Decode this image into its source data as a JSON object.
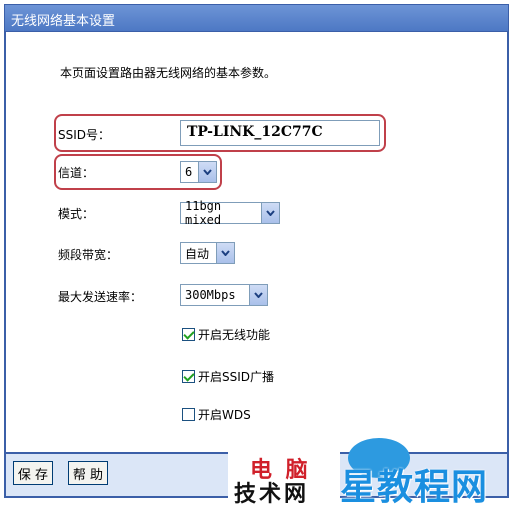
{
  "header": {
    "title": "无线网络基本设置"
  },
  "description": "本页面设置路由器无线网络的基本参数。",
  "form": {
    "ssid": {
      "label": "SSID号：",
      "value": "TP-LINK_12C77C"
    },
    "channel": {
      "label": "信道：",
      "value": "6"
    },
    "mode": {
      "label": "模式：",
      "value": "11bgn mixed"
    },
    "bandwidth": {
      "label": "频段带宽：",
      "value": "自动"
    },
    "max_rate": {
      "label": "最大发送速率：",
      "value": "300Mbps"
    },
    "checkboxes": [
      {
        "label": "开启无线功能",
        "checked": true
      },
      {
        "label": "开启SSID广播",
        "checked": true
      },
      {
        "label": "开启WDS",
        "checked": false
      }
    ]
  },
  "footer": {
    "save_label": "保 存",
    "help_label": "帮 助"
  },
  "watermarks": {
    "line1": "电 脑",
    "line2": "技术网",
    "line3": "星教程网"
  },
  "colors": {
    "title_bg": "#4d78c4",
    "highlight": "#c0404a",
    "footer_bg": "#dbe6f7"
  }
}
